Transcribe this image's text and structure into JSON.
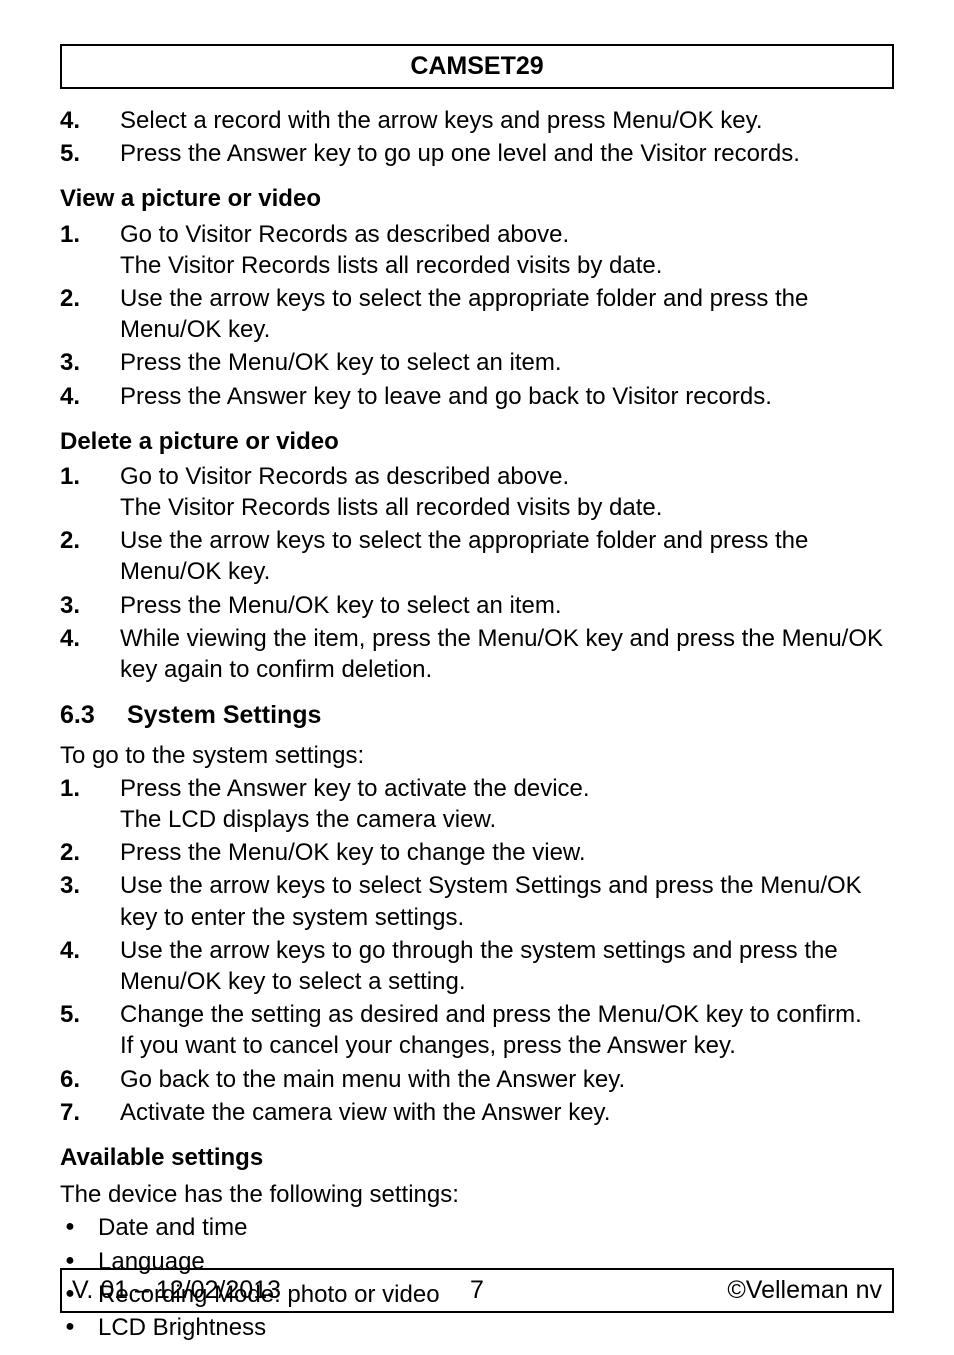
{
  "header": {
    "title": "CAMSET29"
  },
  "intro_list": [
    {
      "num": "4.",
      "text": "Select a record with the arrow keys and press Menu/OK key."
    },
    {
      "num": "5.",
      "text": "Press the Answer key to go up one level and the Visitor records."
    }
  ],
  "view_section": {
    "heading": "View a picture or video",
    "items": [
      {
        "num": "1.",
        "text": "Go to Visitor Records as described above.\nThe Visitor Records lists all recorded visits by date."
      },
      {
        "num": "2.",
        "text": "Use the arrow keys to select the appropriate folder and press the Menu/OK key."
      },
      {
        "num": "3.",
        "text": "Press the Menu/OK key to select an item."
      },
      {
        "num": "4.",
        "text": "Press the Answer key to leave and go back to Visitor records."
      }
    ]
  },
  "delete_section": {
    "heading": "Delete a picture or video",
    "items": [
      {
        "num": "1.",
        "text": "Go to Visitor Records as described above.\nThe Visitor Records lists all recorded visits by date."
      },
      {
        "num": "2.",
        "text": "Use the arrow keys to select the appropriate folder and press the Menu/OK key."
      },
      {
        "num": "3.",
        "text": "Press the Menu/OK key to select an item."
      },
      {
        "num": "4.",
        "text": "While viewing the item, press the Menu/OK key and press the Menu/OK key again to confirm deletion."
      }
    ]
  },
  "system_section": {
    "num": "6.3",
    "title": "System Settings",
    "lead": "To go to the system settings:",
    "items": [
      {
        "num": "1.",
        "text": "Press the Answer key to activate the device.\nThe LCD displays the camera view."
      },
      {
        "num": "2.",
        "text": "Press the Menu/OK key to change the view."
      },
      {
        "num": "3.",
        "text": "Use the arrow keys to select System Settings and press the Menu/OK key to enter the system settings."
      },
      {
        "num": "4.",
        "text": "Use the arrow keys to go through the system settings and press the Menu/OK key to select a setting."
      },
      {
        "num": "5.",
        "text": "Change the setting as desired and press the Menu/OK key to confirm.\nIf you want to cancel your changes, press the Answer key."
      },
      {
        "num": "6.",
        "text": "Go back to the main menu with the Answer key."
      },
      {
        "num": "7.",
        "text": "Activate the camera view with the Answer key."
      }
    ]
  },
  "available_section": {
    "heading": "Available settings",
    "lead": "The device has the following settings:",
    "items": [
      "Date and time",
      "Language",
      "Recording Mode: photo or video",
      "LCD Brightness"
    ]
  },
  "footer": {
    "left": "V. 01 – 12/02/2013",
    "center": "7",
    "right": "©Velleman nv"
  }
}
